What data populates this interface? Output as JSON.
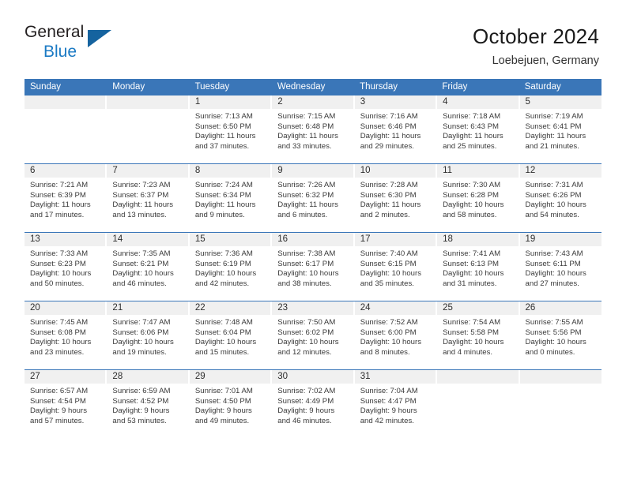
{
  "brand": {
    "name_part1": "General",
    "name_part2": "Blue",
    "accent_color": "#1b7ac4",
    "triangle_color": "#15639f"
  },
  "header": {
    "title": "October 2024",
    "subtitle": "Loebejuen, Germany"
  },
  "theme": {
    "header_blue": "#3a76b8",
    "band_gray": "#f0f0f0",
    "text": "#3a3a3a"
  },
  "weekdays": [
    "Sunday",
    "Monday",
    "Tuesday",
    "Wednesday",
    "Thursday",
    "Friday",
    "Saturday"
  ],
  "weeks": [
    [
      {
        "day": "",
        "lines": []
      },
      {
        "day": "",
        "lines": []
      },
      {
        "day": "1",
        "lines": [
          "Sunrise: 7:13 AM",
          "Sunset: 6:50 PM",
          "Daylight: 11 hours",
          "and 37 minutes."
        ]
      },
      {
        "day": "2",
        "lines": [
          "Sunrise: 7:15 AM",
          "Sunset: 6:48 PM",
          "Daylight: 11 hours",
          "and 33 minutes."
        ]
      },
      {
        "day": "3",
        "lines": [
          "Sunrise: 7:16 AM",
          "Sunset: 6:46 PM",
          "Daylight: 11 hours",
          "and 29 minutes."
        ]
      },
      {
        "day": "4",
        "lines": [
          "Sunrise: 7:18 AM",
          "Sunset: 6:43 PM",
          "Daylight: 11 hours",
          "and 25 minutes."
        ]
      },
      {
        "day": "5",
        "lines": [
          "Sunrise: 7:19 AM",
          "Sunset: 6:41 PM",
          "Daylight: 11 hours",
          "and 21 minutes."
        ]
      }
    ],
    [
      {
        "day": "6",
        "lines": [
          "Sunrise: 7:21 AM",
          "Sunset: 6:39 PM",
          "Daylight: 11 hours",
          "and 17 minutes."
        ]
      },
      {
        "day": "7",
        "lines": [
          "Sunrise: 7:23 AM",
          "Sunset: 6:37 PM",
          "Daylight: 11 hours",
          "and 13 minutes."
        ]
      },
      {
        "day": "8",
        "lines": [
          "Sunrise: 7:24 AM",
          "Sunset: 6:34 PM",
          "Daylight: 11 hours",
          "and 9 minutes."
        ]
      },
      {
        "day": "9",
        "lines": [
          "Sunrise: 7:26 AM",
          "Sunset: 6:32 PM",
          "Daylight: 11 hours",
          "and 6 minutes."
        ]
      },
      {
        "day": "10",
        "lines": [
          "Sunrise: 7:28 AM",
          "Sunset: 6:30 PM",
          "Daylight: 11 hours",
          "and 2 minutes."
        ]
      },
      {
        "day": "11",
        "lines": [
          "Sunrise: 7:30 AM",
          "Sunset: 6:28 PM",
          "Daylight: 10 hours",
          "and 58 minutes."
        ]
      },
      {
        "day": "12",
        "lines": [
          "Sunrise: 7:31 AM",
          "Sunset: 6:26 PM",
          "Daylight: 10 hours",
          "and 54 minutes."
        ]
      }
    ],
    [
      {
        "day": "13",
        "lines": [
          "Sunrise: 7:33 AM",
          "Sunset: 6:23 PM",
          "Daylight: 10 hours",
          "and 50 minutes."
        ]
      },
      {
        "day": "14",
        "lines": [
          "Sunrise: 7:35 AM",
          "Sunset: 6:21 PM",
          "Daylight: 10 hours",
          "and 46 minutes."
        ]
      },
      {
        "day": "15",
        "lines": [
          "Sunrise: 7:36 AM",
          "Sunset: 6:19 PM",
          "Daylight: 10 hours",
          "and 42 minutes."
        ]
      },
      {
        "day": "16",
        "lines": [
          "Sunrise: 7:38 AM",
          "Sunset: 6:17 PM",
          "Daylight: 10 hours",
          "and 38 minutes."
        ]
      },
      {
        "day": "17",
        "lines": [
          "Sunrise: 7:40 AM",
          "Sunset: 6:15 PM",
          "Daylight: 10 hours",
          "and 35 minutes."
        ]
      },
      {
        "day": "18",
        "lines": [
          "Sunrise: 7:41 AM",
          "Sunset: 6:13 PM",
          "Daylight: 10 hours",
          "and 31 minutes."
        ]
      },
      {
        "day": "19",
        "lines": [
          "Sunrise: 7:43 AM",
          "Sunset: 6:11 PM",
          "Daylight: 10 hours",
          "and 27 minutes."
        ]
      }
    ],
    [
      {
        "day": "20",
        "lines": [
          "Sunrise: 7:45 AM",
          "Sunset: 6:08 PM",
          "Daylight: 10 hours",
          "and 23 minutes."
        ]
      },
      {
        "day": "21",
        "lines": [
          "Sunrise: 7:47 AM",
          "Sunset: 6:06 PM",
          "Daylight: 10 hours",
          "and 19 minutes."
        ]
      },
      {
        "day": "22",
        "lines": [
          "Sunrise: 7:48 AM",
          "Sunset: 6:04 PM",
          "Daylight: 10 hours",
          "and 15 minutes."
        ]
      },
      {
        "day": "23",
        "lines": [
          "Sunrise: 7:50 AM",
          "Sunset: 6:02 PM",
          "Daylight: 10 hours",
          "and 12 minutes."
        ]
      },
      {
        "day": "24",
        "lines": [
          "Sunrise: 7:52 AM",
          "Sunset: 6:00 PM",
          "Daylight: 10 hours",
          "and 8 minutes."
        ]
      },
      {
        "day": "25",
        "lines": [
          "Sunrise: 7:54 AM",
          "Sunset: 5:58 PM",
          "Daylight: 10 hours",
          "and 4 minutes."
        ]
      },
      {
        "day": "26",
        "lines": [
          "Sunrise: 7:55 AM",
          "Sunset: 5:56 PM",
          "Daylight: 10 hours",
          "and 0 minutes."
        ]
      }
    ],
    [
      {
        "day": "27",
        "lines": [
          "Sunrise: 6:57 AM",
          "Sunset: 4:54 PM",
          "Daylight: 9 hours",
          "and 57 minutes."
        ]
      },
      {
        "day": "28",
        "lines": [
          "Sunrise: 6:59 AM",
          "Sunset: 4:52 PM",
          "Daylight: 9 hours",
          "and 53 minutes."
        ]
      },
      {
        "day": "29",
        "lines": [
          "Sunrise: 7:01 AM",
          "Sunset: 4:50 PM",
          "Daylight: 9 hours",
          "and 49 minutes."
        ]
      },
      {
        "day": "30",
        "lines": [
          "Sunrise: 7:02 AM",
          "Sunset: 4:49 PM",
          "Daylight: 9 hours",
          "and 46 minutes."
        ]
      },
      {
        "day": "31",
        "lines": [
          "Sunrise: 7:04 AM",
          "Sunset: 4:47 PM",
          "Daylight: 9 hours",
          "and 42 minutes."
        ]
      },
      {
        "day": "",
        "lines": []
      },
      {
        "day": "",
        "lines": []
      }
    ]
  ]
}
